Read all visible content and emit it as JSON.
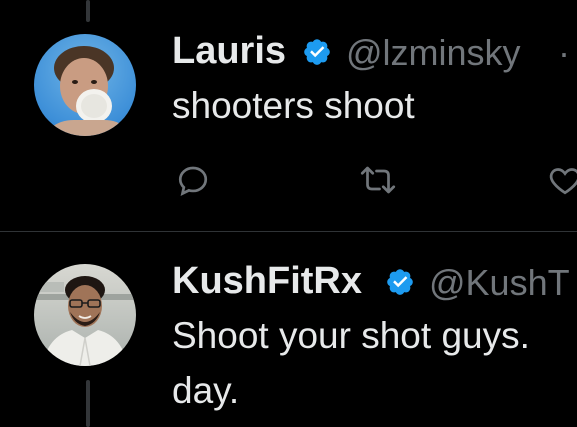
{
  "posts": [
    {
      "display_name": "Lauris",
      "handle": "@lzminsky",
      "separator": "·",
      "text_lines": [
        "shooters shoot"
      ],
      "verified": true
    },
    {
      "display_name": "KushFitRx",
      "handle": "@KushT",
      "text_lines": [
        "Shoot your shot guys.",
        "day."
      ],
      "verified": true
    }
  ],
  "actions": [
    "reply-icon",
    "repost-icon",
    "like-icon"
  ],
  "colors": {
    "background": "#000000",
    "text": "#e7e9ea",
    "muted": "#71767b",
    "verified": "#1d9bf0",
    "divider": "#2f3336"
  }
}
